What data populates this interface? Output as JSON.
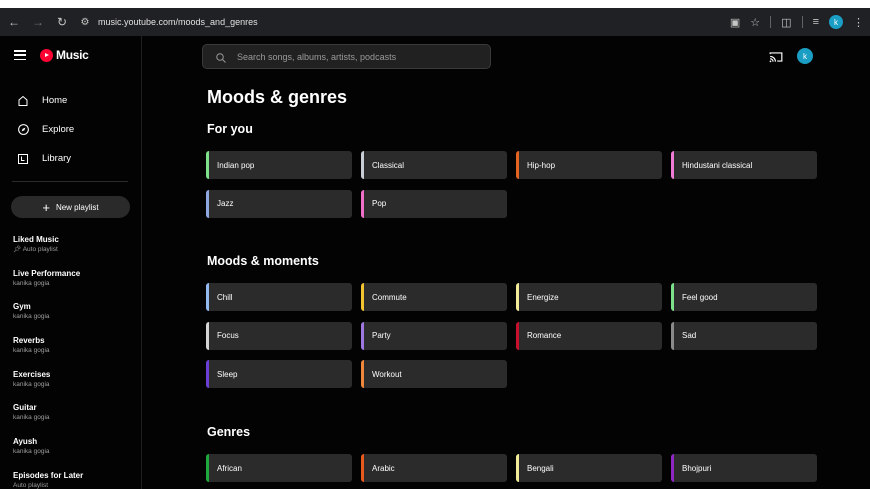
{
  "browser": {
    "url": "music.youtube.com/moods_and_genres",
    "avatar_letter": "k",
    "icons": [
      "back-arrow",
      "forward-arrow",
      "reload",
      "site-settings",
      "install-app",
      "star",
      "extensions",
      "media-controls",
      "profile",
      "menu"
    ]
  },
  "app": {
    "logo_text": "Music",
    "nav": [
      {
        "label": "Home",
        "icon": "home-icon"
      },
      {
        "label": "Explore",
        "icon": "compass-icon"
      },
      {
        "label": "Library",
        "icon": "library-icon"
      }
    ],
    "new_playlist_label": "New playlist",
    "playlists": [
      {
        "name": "Liked Music",
        "sub": "Auto playlist",
        "pinned": true
      },
      {
        "name": "Live Performance",
        "sub": "kanika gogia"
      },
      {
        "name": "Gym",
        "sub": "kanika gogia"
      },
      {
        "name": "Reverbs",
        "sub": "kanika gogia"
      },
      {
        "name": "Exercises",
        "sub": "kanika gogia"
      },
      {
        "name": "Guitar",
        "sub": "kanika gogia"
      },
      {
        "name": "Ayush",
        "sub": "kanika gogia"
      },
      {
        "name": "Episodes for Later",
        "sub": "Auto playlist"
      }
    ],
    "search_placeholder": "Search songs, albums, artists, podcasts",
    "user_avatar_letter": "k"
  },
  "page": {
    "title": "Moods & genres",
    "sections": [
      {
        "title": "For you",
        "chips": [
          {
            "label": "Indian pop",
            "color": "#7ee08a"
          },
          {
            "label": "Classical",
            "color": "#c9cdd6"
          },
          {
            "label": "Hip-hop",
            "color": "#e4641f"
          },
          {
            "label": "Hindustani classical",
            "color": "#f07bd4"
          },
          {
            "label": "Jazz",
            "color": "#8fa7e0"
          },
          {
            "label": "Pop",
            "color": "#f06fc9"
          }
        ]
      },
      {
        "title": "Moods & moments",
        "chips": [
          {
            "label": "Chill",
            "color": "#92b9f0"
          },
          {
            "label": "Commute",
            "color": "#f2c230"
          },
          {
            "label": "Energize",
            "color": "#f3eb97"
          },
          {
            "label": "Feel good",
            "color": "#7ee08a"
          },
          {
            "label": "Focus",
            "color": "#d5d5d5"
          },
          {
            "label": "Party",
            "color": "#9e78e0"
          },
          {
            "label": "Romance",
            "color": "#c8102e"
          },
          {
            "label": "Sad",
            "color": "#8a8a8a"
          },
          {
            "label": "Sleep",
            "color": "#6a3fd6"
          },
          {
            "label": "Workout",
            "color": "#f0873a"
          }
        ]
      },
      {
        "title": "Genres",
        "chips": [
          {
            "label": "African",
            "color": "#1fa83e"
          },
          {
            "label": "Arabic",
            "color": "#e85a1c"
          },
          {
            "label": "Bengali",
            "color": "#f3eb97"
          },
          {
            "label": "Bhojpuri",
            "color": "#8e26c4"
          }
        ]
      }
    ]
  }
}
